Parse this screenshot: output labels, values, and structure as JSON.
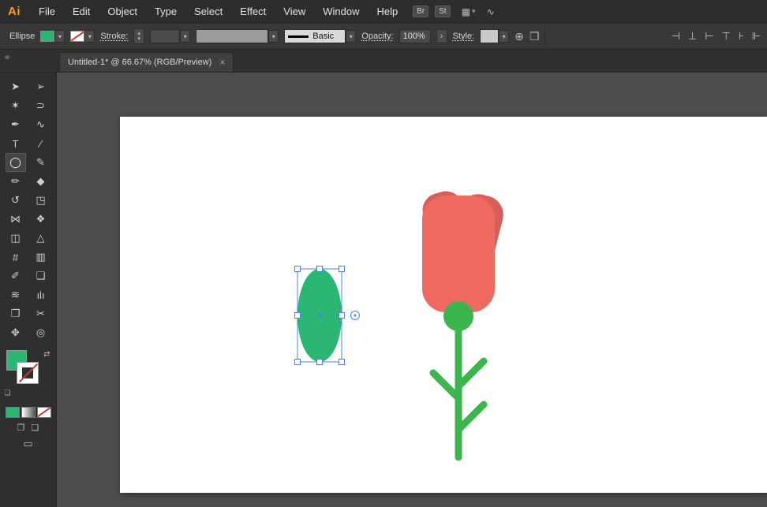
{
  "app": {
    "logo": "Ai",
    "menus": [
      "File",
      "Edit",
      "Object",
      "Type",
      "Select",
      "Effect",
      "View",
      "Window",
      "Help"
    ],
    "bridge": "Br",
    "stock": "St"
  },
  "control_bar": {
    "context_label": "Ellipse",
    "stroke_label": "Stroke:",
    "stroke_style": "Basic",
    "opacity_label": "Opacity:",
    "opacity_value": "100%",
    "style_label": "Style:"
  },
  "document_tab": {
    "title": "Untitled-1* @ 66.67% (RGB/Preview)",
    "close": "×"
  },
  "toolbar": {
    "tools": [
      {
        "name": "selection-tool",
        "glyph": "➤"
      },
      {
        "name": "direct-selection-tool",
        "glyph": "➢"
      },
      {
        "name": "magic-wand-tool",
        "glyph": "✶"
      },
      {
        "name": "lasso-tool",
        "glyph": "⊃"
      },
      {
        "name": "pen-tool",
        "glyph": "✒"
      },
      {
        "name": "curvature-tool",
        "glyph": "∿"
      },
      {
        "name": "type-tool",
        "glyph": "T"
      },
      {
        "name": "line-tool",
        "glyph": "∕"
      },
      {
        "name": "ellipse-tool",
        "glyph": "◯"
      },
      {
        "name": "paintbrush-tool",
        "glyph": "✎"
      },
      {
        "name": "pencil-tool",
        "glyph": "✏"
      },
      {
        "name": "eraser-tool",
        "glyph": "◆"
      },
      {
        "name": "rotate-tool",
        "glyph": "↺"
      },
      {
        "name": "scale-tool",
        "glyph": "◳"
      },
      {
        "name": "width-tool",
        "glyph": "⋈"
      },
      {
        "name": "free-transform-tool",
        "glyph": "❖"
      },
      {
        "name": "shape-builder-tool",
        "glyph": "◫"
      },
      {
        "name": "perspective-grid-tool",
        "glyph": "△"
      },
      {
        "name": "mesh-tool",
        "glyph": "#"
      },
      {
        "name": "gradient-tool",
        "glyph": "▥"
      },
      {
        "name": "eyedropper-tool",
        "glyph": "✐"
      },
      {
        "name": "blend-tool",
        "glyph": "❏"
      },
      {
        "name": "symbol-sprayer-tool",
        "glyph": "≋"
      },
      {
        "name": "column-graph-tool",
        "glyph": "ılı"
      },
      {
        "name": "artboard-tool",
        "glyph": "❐"
      },
      {
        "name": "slice-tool",
        "glyph": "✂"
      },
      {
        "name": "hand-tool",
        "glyph": "✥"
      },
      {
        "name": "zoom-tool",
        "glyph": "◎"
      }
    ]
  },
  "icons": {
    "workspace": "▦",
    "chevron": "▾",
    "gpu": "∿",
    "globe": "⊕",
    "transform": "❐",
    "align_left": "⊣",
    "align_center": "⊥",
    "align_right": "⊢",
    "align_top": "⊤",
    "align_mid": "⊦",
    "align_bottom": "⊩",
    "collapse": "«",
    "swap": "⇄",
    "mini_swatches": "❏",
    "draw_normal": "❐",
    "draw_behind": "❏",
    "screen_mode": "▭",
    "stepper_up": "▴",
    "stepper_down": "▾",
    "arrow_right": "›"
  },
  "colors": {
    "fill_green": "#2cb673",
    "stem_green": "#3cb54c",
    "petal_coral": "#ee6a60",
    "petal_dark": "#d85f57",
    "selection_blue": "#4a82e8",
    "logo_orange": "#ff9a23"
  }
}
